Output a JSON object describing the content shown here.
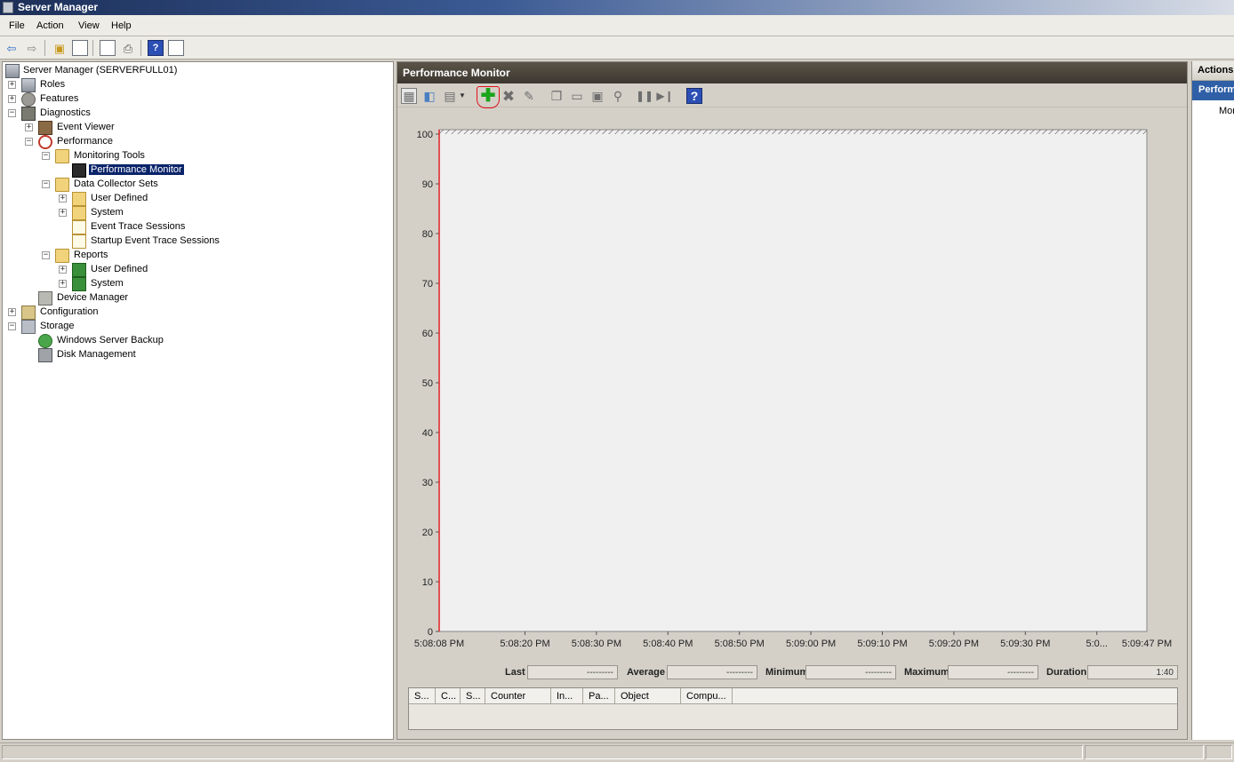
{
  "window": {
    "title": "Server Manager"
  },
  "menu": [
    "File",
    "Action",
    "View",
    "Help"
  ],
  "tree": {
    "root": "Server Manager (SERVERFULL01)",
    "roles": "Roles",
    "features": "Features",
    "diagnostics": "Diagnostics",
    "event_viewer": "Event Viewer",
    "performance": "Performance",
    "monitoring_tools": "Monitoring Tools",
    "performance_monitor": "Performance Monitor",
    "data_collector_sets": "Data Collector Sets",
    "dcs_user_defined": "User Defined",
    "dcs_system": "System",
    "event_trace_sessions": "Event Trace Sessions",
    "startup_event_trace_sessions": "Startup Event Trace Sessions",
    "reports": "Reports",
    "rep_user_defined": "User Defined",
    "rep_system": "System",
    "device_manager": "Device Manager",
    "configuration": "Configuration",
    "storage": "Storage",
    "windows_server_backup": "Windows Server Backup",
    "disk_management": "Disk Management"
  },
  "center": {
    "title": "Performance Monitor"
  },
  "chart_data": {
    "type": "line",
    "title": "",
    "ylim": [
      0,
      100
    ],
    "yticks": [
      0,
      10,
      20,
      30,
      40,
      50,
      60,
      70,
      80,
      90,
      100
    ],
    "xticks": [
      "5:08:08 PM",
      "5:08:20 PM",
      "5:08:30 PM",
      "5:08:40 PM",
      "5:08:50 PM",
      "5:09:00 PM",
      "5:09:10 PM",
      "5:09:20 PM",
      "5:09:30 PM",
      "5:0...",
      "5:09:47 PM"
    ],
    "series": [],
    "grid": true,
    "timeline_color": "#e02020",
    "plot_background": "#f0f0f0"
  },
  "stats": {
    "last_label": "Last",
    "last_value": "---------",
    "average_label": "Average",
    "average_value": "---------",
    "minimum_label": "Minimum",
    "minimum_value": "---------",
    "maximum_label": "Maximum",
    "maximum_value": "---------",
    "duration_label": "Duration",
    "duration_value": "1:40"
  },
  "counter_columns": [
    "S...",
    "C...",
    "S...",
    "Counter",
    "In...",
    "Pa...",
    "Object",
    "Compu..."
  ],
  "actions": {
    "header": "Actions",
    "section": "Perform",
    "item": "Mor"
  },
  "colors": {
    "selection": "#0a246a",
    "header_dark": "#3b3630",
    "actions_accent": "#2f5fa6",
    "highlight_circle": "#e0101a"
  }
}
